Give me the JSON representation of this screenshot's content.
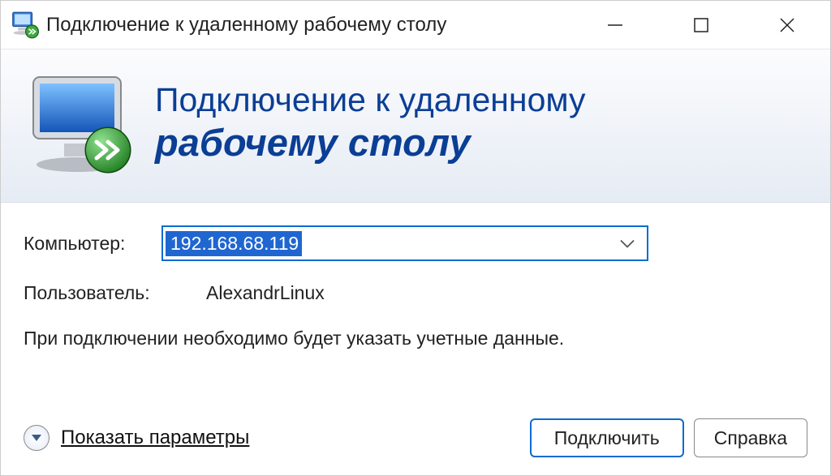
{
  "title": "Подключение к удаленному рабочему столу",
  "banner": {
    "line1": "Подключение к удаленному",
    "line2": "рабочему столу"
  },
  "form": {
    "computer_label": "Компьютер:",
    "computer_value": "192.168.68.119",
    "user_label": "Пользователь:",
    "user_value": "AlexandrLinux",
    "hint": "При подключении необходимо будет указать учетные данные."
  },
  "footer": {
    "options_label": "Показать параметры",
    "connect_label": "Подключить",
    "help_label": "Справка"
  }
}
